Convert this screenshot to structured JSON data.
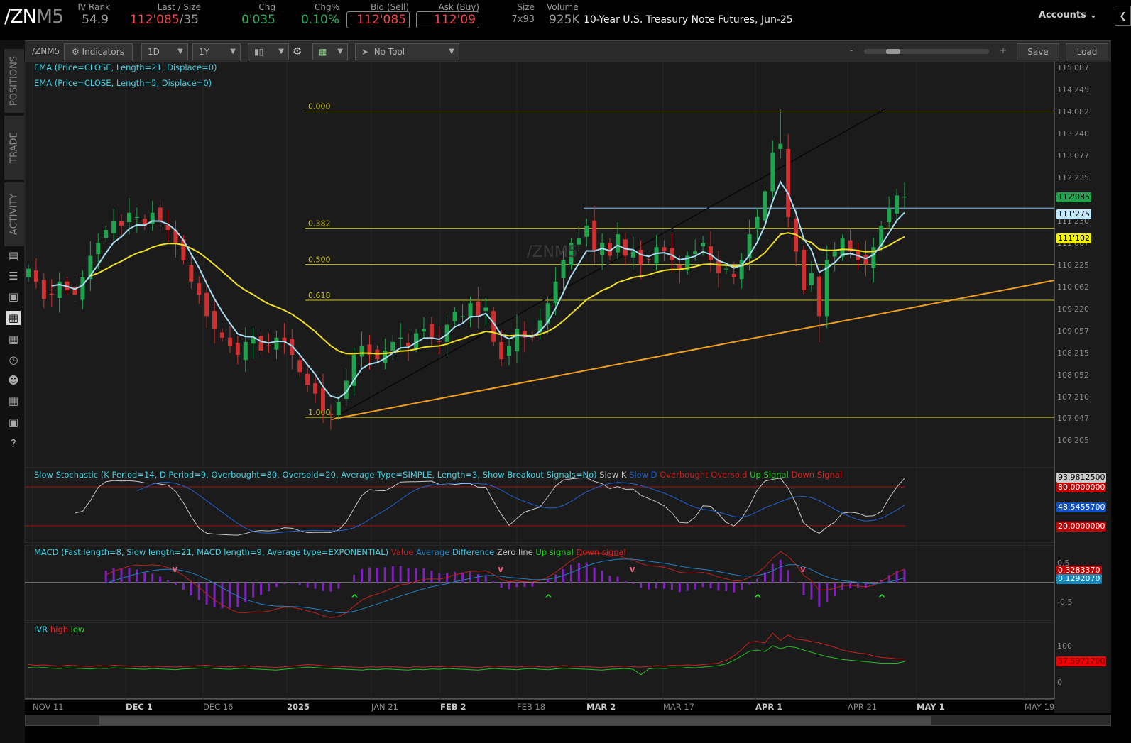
{
  "header": {
    "symbol_main": "/ZN",
    "symbol_suffix": "M5",
    "iv_rank_label": "IV Rank",
    "iv_rank": "54.9",
    "last_label": "Last / Size",
    "last": "112'085",
    "last_size": "/35",
    "chg_label": "Chg",
    "chg": "0'035",
    "chgpct_label": "Chg%",
    "chgpct": "0.10%",
    "bid_label": "Bid (Sell)",
    "bid": "112'085",
    "ask_label": "Ask (Buy)",
    "ask": "112'09",
    "size_label": "Size",
    "size": "7x93",
    "volume_label": "Volume",
    "volume": "925K",
    "description": "10-Year U.S. Treasury Note Futures, Jun-25",
    "accounts": "Accounts"
  },
  "toolbar": {
    "symbol": "/ZNM5",
    "indicators": "Indicators",
    "aggregation": "1D",
    "timeframe": "1Y",
    "drawing_tool": "No Tool",
    "zoom_minus": "-",
    "zoom_plus": "+",
    "save": "Save",
    "load": "Load"
  },
  "sidebar": {
    "tabs": [
      "POSITIONS",
      "TRADE",
      "ACTIVITY"
    ]
  },
  "chart": {
    "watermark": "/ZNM5",
    "ema21_label": "EMA (Price=CLOSE, Length=21, Displace=0)",
    "ema5_label": "EMA (Price=CLOSE, Length=5, Displace=0)",
    "fib_levels": [
      {
        "label": "0.000",
        "price": 114.26
      },
      {
        "label": "0.382",
        "price": 111.54
      },
      {
        "label": "0.500",
        "price": 110.7
      },
      {
        "label": "0.618",
        "price": 109.87
      },
      {
        "label": "1.000",
        "price": 107.15
      }
    ],
    "resistance_price": 112.0,
    "price_axis": [
      "115'087",
      "114'245",
      "114'082",
      "113'240",
      "113'077",
      "112'235",
      "",
      "111'230",
      "111'067",
      "110'225",
      "110'062",
      "109'220",
      "109'057",
      "108'215",
      "108'052",
      "107'210",
      "107'047",
      "106'205"
    ],
    "last_tag": "112'085",
    "ema5_tag": "111'275",
    "ema21_tag": "111'102",
    "closes": [
      110.6,
      110.3,
      109.9,
      110.0,
      110.3,
      110.1,
      110.0,
      110.4,
      110.9,
      111.2,
      111.5,
      111.7,
      111.6,
      111.9,
      111.8,
      111.6,
      111.9,
      111.7,
      111.5,
      111.2,
      110.8,
      110.3,
      110.0,
      109.5,
      109.2,
      109.0,
      108.8,
      108.6,
      108.9,
      109.0,
      108.7,
      108.8,
      109.0,
      108.9,
      108.6,
      108.2,
      107.9,
      107.7,
      107.3,
      107.2,
      107.5,
      108.0,
      108.6,
      108.8,
      108.6,
      108.5,
      108.7,
      108.9,
      109.0,
      108.8,
      109.1,
      109.2,
      109.0,
      108.9,
      109.3,
      109.6,
      109.5,
      109.8,
      109.5,
      109.7,
      108.9,
      108.5,
      108.8,
      109.2,
      109.0,
      109.0,
      109.4,
      109.8,
      110.3,
      110.8,
      111.2,
      111.3,
      111.6,
      111.0,
      111.2,
      110.9,
      111.4,
      110.9,
      111.0,
      110.7,
      110.8,
      111.1,
      111.0,
      110.8,
      110.6,
      110.9,
      111.0,
      111.2,
      110.8,
      110.5,
      110.6,
      110.4,
      110.8,
      111.4,
      111.8,
      112.4,
      113.3,
      113.5,
      111.8,
      111.0,
      110.1,
      110.5,
      109.5,
      110.8,
      111.0,
      111.3,
      111.0,
      110.8,
      110.7,
      111.1,
      111.6,
      112.0,
      112.3,
      112.27
    ]
  },
  "stochastic": {
    "label": "Slow Stochastic (K Period=14, D Period=9, Overbought=80, Oversold=20, Average Type=SIMPLE, Length=3, Show Breakout Signals=No)",
    "legend": [
      {
        "t": "Slow K",
        "c": "#c8c8c8"
      },
      {
        "t": "Slow D",
        "c": "#2060d0"
      },
      {
        "t": "Overbought",
        "c": "#c02020"
      },
      {
        "t": "Oversold",
        "c": "#c02020"
      },
      {
        "t": "Up Signal",
        "c": "#20d020"
      },
      {
        "t": "Down Signal",
        "c": "#e02020"
      }
    ],
    "k_tag": "93.9812500",
    "ob_tag": "80.0000000",
    "d_tag": "48.5455700",
    "os_tag": "20.0000000"
  },
  "macd": {
    "label": "MACD (Fast length=8, Slow length=21, MACD length=9, Average type=EXPONENTIAL)",
    "legend": [
      {
        "t": "Value",
        "c": "#c02020"
      },
      {
        "t": "Average",
        "c": "#2080c0"
      },
      {
        "t": "Difference",
        "c": "#40c0e0"
      },
      {
        "t": "Zero line",
        "c": "#c8c8c8"
      },
      {
        "t": "Up signal",
        "c": "#20d020"
      },
      {
        "t": "Down signal",
        "c": "#e02020"
      }
    ],
    "axis": [
      "0.5",
      "-0.5"
    ],
    "value_tag": "0.3283370",
    "avg_tag": "0.1292070"
  },
  "ivr": {
    "label": "IVR",
    "legend": [
      {
        "t": "high",
        "c": "#e02020"
      },
      {
        "t": "low",
        "c": "#20d020"
      }
    ],
    "axis": [
      "100",
      "0"
    ],
    "tag": "57.5971700",
    "high": [
      48,
      46,
      47,
      45,
      44,
      46,
      45,
      44,
      43,
      45,
      44,
      46,
      45,
      44,
      43,
      42,
      44,
      43,
      42,
      41,
      43,
      44,
      45,
      46,
      44,
      43,
      42,
      44,
      45,
      43,
      42,
      41,
      40,
      42,
      44,
      46,
      48,
      47,
      45,
      44,
      43,
      42,
      41,
      40,
      42,
      41,
      43,
      42,
      41,
      40,
      42,
      41,
      43,
      42,
      44,
      43,
      42,
      41,
      40,
      42,
      44,
      43,
      42,
      41,
      43,
      44,
      42,
      41,
      43,
      45,
      44,
      43,
      42,
      41,
      40,
      42,
      43,
      44,
      42,
      41,
      43,
      45,
      44,
      46,
      45,
      47,
      46,
      48,
      50,
      52,
      60,
      72,
      90,
      110,
      112,
      108,
      135,
      115,
      130,
      118,
      116,
      112,
      108,
      102,
      96,
      88,
      84,
      80,
      78,
      72,
      68,
      66,
      64,
      64
    ],
    "low": [
      40,
      39,
      40,
      38,
      37,
      39,
      38,
      37,
      36,
      38,
      37,
      39,
      38,
      37,
      36,
      35,
      37,
      36,
      35,
      34,
      36,
      37,
      38,
      39,
      37,
      36,
      35,
      37,
      38,
      36,
      35,
      34,
      33,
      35,
      37,
      39,
      41,
      40,
      38,
      37,
      36,
      35,
      34,
      33,
      35,
      34,
      36,
      35,
      34,
      33,
      35,
      34,
      36,
      35,
      37,
      36,
      35,
      34,
      33,
      35,
      37,
      36,
      35,
      34,
      36,
      37,
      35,
      34,
      36,
      38,
      37,
      36,
      35,
      34,
      33,
      35,
      36,
      37,
      35,
      20,
      36,
      38,
      37,
      39,
      38,
      40,
      39,
      41,
      43,
      45,
      50,
      60,
      72,
      85,
      88,
      84,
      100,
      92,
      98,
      95,
      88,
      82,
      76,
      70,
      66,
      62,
      60,
      58,
      56,
      54,
      52,
      52,
      52,
      56
    ]
  },
  "x_axis": [
    "NOV 11",
    "DEC 1",
    "DEC 16",
    "2025",
    "JAN 21",
    "FEB 2",
    "FEB 18",
    "MAR 2",
    "MAR 17",
    "APR 1",
    "APR 21",
    "MAY 1",
    "MAY 19"
  ],
  "colors": {
    "up": "#1fa34f",
    "down": "#d03030",
    "ema5": "#a8dcf0",
    "ema21": "#f0e020",
    "fib": "#c8c020",
    "trend": "#f0a020",
    "bg": "#1b1b1b"
  }
}
